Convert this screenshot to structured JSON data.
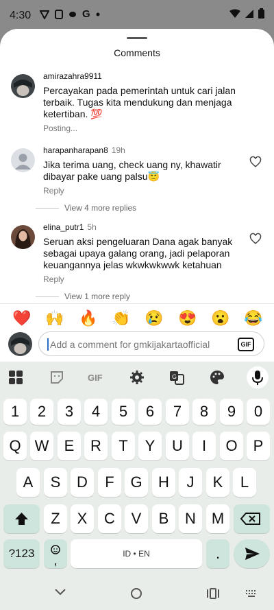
{
  "status": {
    "time": "4:30",
    "icons": [
      "shield-v-icon",
      "device-icon",
      "messenger-icon",
      "google-icon",
      "dot-icon"
    ],
    "right_icons": [
      "wifi-icon",
      "signal-icon",
      "battery-icon"
    ]
  },
  "sheet": {
    "title": "Comments"
  },
  "comments": [
    {
      "username": "amirazahra9911",
      "time": "",
      "text": "Percayakan pada pemerintah untuk cari jalan terbaik. Tugas kita mendukung dan menjaga ketertiban. 💯",
      "meta": "Posting..."
    },
    {
      "username": "harapanharapan8",
      "time": "19h",
      "text": "Jika terima uang, check uang ny, khawatir dibayar pake uang palsu😇",
      "meta": "Reply",
      "more": "View 4 more replies"
    },
    {
      "username": "elina_putr1",
      "time": "5h",
      "text": "Seruan aksi pengeluaran Dana agak banyak sebagai upaya galang orang, jadi pelaporan keuangannya jelas wkwkwkwwk ketahuan",
      "meta": "Reply",
      "more": "View 1 more reply"
    }
  ],
  "emojis": [
    "❤️",
    "🙌",
    "🔥",
    "👏",
    "😢",
    "😍",
    "😮",
    "😂"
  ],
  "composer": {
    "placeholder": "Add a comment for gmkijakartaofficial",
    "gif_label": "GIF"
  },
  "keyboard": {
    "toolbar_gif": "GIF",
    "numbers": [
      "1",
      "2",
      "3",
      "4",
      "5",
      "6",
      "7",
      "8",
      "9",
      "0"
    ],
    "row1": [
      "Q",
      "W",
      "E",
      "R",
      "T",
      "Y",
      "U",
      "I",
      "O",
      "P"
    ],
    "row2": [
      "A",
      "S",
      "D",
      "F",
      "G",
      "H",
      "J",
      "K",
      "L"
    ],
    "row3": [
      "Z",
      "X",
      "C",
      "V",
      "B",
      "N",
      "M"
    ],
    "symbols_label": "?123",
    "comma_label": ",",
    "space_label": "ID • EN",
    "period_label": "."
  }
}
